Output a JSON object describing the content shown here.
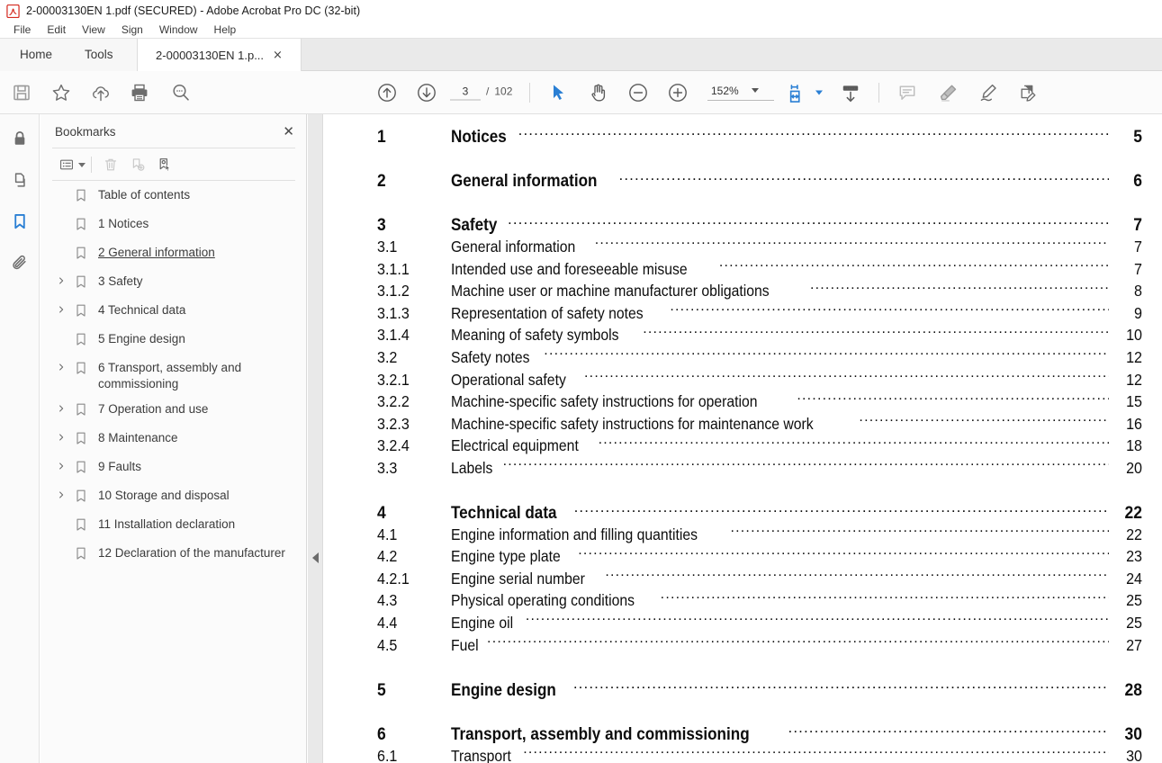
{
  "window": {
    "title": "2-00003130EN 1.pdf (SECURED) - Adobe Acrobat Pro DC (32-bit)",
    "app_icon": "acrobat-icon"
  },
  "menubar": {
    "items": [
      "File",
      "Edit",
      "View",
      "Sign",
      "Window",
      "Help"
    ]
  },
  "tabstrip": {
    "home_label": "Home",
    "tools_label": "Tools",
    "document_tab_label": "2-00003130EN 1.p...",
    "close_glyph": "×"
  },
  "toolbar": {
    "left_icons": [
      "save-icon",
      "star-icon",
      "cloud-upload-icon",
      "print-icon",
      "search-icon"
    ],
    "nav": {
      "previous_page_icon": "arrow-up-circle-icon",
      "next_page_icon": "arrow-down-circle-icon",
      "current_page": "3",
      "page_separator": "/",
      "total_pages": "102"
    },
    "tools": {
      "select_icon": "cursor-arrow-icon",
      "pan_icon": "hand-icon",
      "zoom_out_icon": "minus-circle-icon",
      "zoom_in_icon": "plus-circle-icon",
      "zoom_level": "152%",
      "zoom_dropdown_icon": "chevron-down-icon"
    },
    "right_tools": {
      "fit_page_icon": "fit-page-icon",
      "fit_page_dropdown_icon": "chevron-down-icon",
      "scroll_mode_icon": "scroll-mode-icon",
      "comment_icon": "comment-icon",
      "highlight_icon": "highlight-marker-icon",
      "sign_icon": "sign-pen-icon",
      "fill_and_sign_icon": "fill-and-sign-icon"
    }
  },
  "rail": {
    "items": [
      {
        "name": "security-lock-icon",
        "active": false
      },
      {
        "name": "page-thumbnails-icon",
        "active": false
      },
      {
        "name": "bookmarks-icon",
        "active": true
      },
      {
        "name": "attachments-icon",
        "active": false
      }
    ]
  },
  "panel": {
    "title": "Bookmarks",
    "close_glyph": "✕",
    "tools": {
      "options_icon": "bookmark-options-icon",
      "options_caret_icon": "chevron-down-icon",
      "delete_icon": "trash-icon",
      "new_bookmark_icon": "new-bookmark-icon",
      "select_bookmark_icon": "select-bookmark-icon"
    },
    "bookmarks": [
      {
        "label": "Table of contents",
        "expandable": false,
        "underlined": false
      },
      {
        "label": "1 Notices",
        "expandable": false,
        "underlined": false
      },
      {
        "label": "2 General information",
        "expandable": false,
        "underlined": true
      },
      {
        "label": "3 Safety",
        "expandable": true,
        "underlined": false
      },
      {
        "label": "4 Technical data",
        "expandable": true,
        "underlined": false
      },
      {
        "label": "5 Engine design",
        "expandable": false,
        "underlined": false
      },
      {
        "label": "6 Transport, assembly and commissioning",
        "expandable": true,
        "underlined": false
      },
      {
        "label": "7 Operation and use",
        "expandable": true,
        "underlined": false
      },
      {
        "label": "8 Maintenance",
        "expandable": true,
        "underlined": false
      },
      {
        "label": "9 Faults",
        "expandable": true,
        "underlined": false
      },
      {
        "label": "10 Storage and disposal",
        "expandable": true,
        "underlined": false
      },
      {
        "label": "11 Installation declaration",
        "expandable": false,
        "underlined": false
      },
      {
        "label": "12 Declaration of the manufacturer",
        "expandable": false,
        "underlined": false
      }
    ]
  },
  "splitter": {
    "collapse_icon": "collapse-panel-triangle-icon"
  },
  "document": {
    "toc_entries": [
      {
        "num": "1",
        "title": "Notices",
        "page": "5",
        "level": 1,
        "gap_before": false
      },
      {
        "num": "2",
        "title": "General information",
        "page": "6",
        "level": 1,
        "gap_before": true
      },
      {
        "num": "3",
        "title": "Safety",
        "page": "7",
        "level": 1,
        "gap_before": true
      },
      {
        "num": "3.1",
        "title": "General information",
        "page": "7",
        "level": 2,
        "gap_before": false
      },
      {
        "num": "3.1.1",
        "title": "Intended use and foreseeable misuse",
        "page": "7",
        "level": 2,
        "gap_before": false
      },
      {
        "num": "3.1.2",
        "title": "Machine user or machine manufacturer obligations",
        "page": "8",
        "level": 2,
        "gap_before": false
      },
      {
        "num": "3.1.3",
        "title": "Representation of safety notes",
        "page": "9",
        "level": 2,
        "gap_before": false
      },
      {
        "num": "3.1.4",
        "title": "Meaning of safety symbols",
        "page": "10",
        "level": 2,
        "gap_before": false
      },
      {
        "num": "3.2",
        "title": "Safety notes",
        "page": "12",
        "level": 2,
        "gap_before": false
      },
      {
        "num": "3.2.1",
        "title": "Operational safety",
        "page": "12",
        "level": 2,
        "gap_before": false
      },
      {
        "num": "3.2.2",
        "title": "Machine-specific safety instructions for operation",
        "page": "15",
        "level": 2,
        "gap_before": false
      },
      {
        "num": "3.2.3",
        "title": "Machine-specific safety instructions for maintenance work",
        "page": "16",
        "level": 2,
        "gap_before": false
      },
      {
        "num": "3.2.4",
        "title": "Electrical equipment",
        "page": "18",
        "level": 2,
        "gap_before": false
      },
      {
        "num": "3.3",
        "title": "Labels",
        "page": "20",
        "level": 2,
        "gap_before": false
      },
      {
        "num": "4",
        "title": "Technical data",
        "page": "22",
        "level": 1,
        "gap_before": true
      },
      {
        "num": "4.1",
        "title": "Engine information and filling quantities",
        "page": "22",
        "level": 2,
        "gap_before": false
      },
      {
        "num": "4.2",
        "title": "Engine type plate",
        "page": "23",
        "level": 2,
        "gap_before": false
      },
      {
        "num": "4.2.1",
        "title": "Engine serial number",
        "page": "24",
        "level": 2,
        "gap_before": false
      },
      {
        "num": "4.3",
        "title": "Physical operating conditions",
        "page": "25",
        "level": 2,
        "gap_before": false
      },
      {
        "num": "4.4",
        "title": "Engine oil",
        "page": "25",
        "level": 2,
        "gap_before": false
      },
      {
        "num": "4.5",
        "title": "Fuel",
        "page": "27",
        "level": 2,
        "gap_before": false
      },
      {
        "num": "5",
        "title": "Engine design",
        "page": "28",
        "level": 1,
        "gap_before": true
      },
      {
        "num": "6",
        "title": "Transport, assembly and commissioning",
        "page": "30",
        "level": 1,
        "gap_before": true
      },
      {
        "num": "6.1",
        "title": "Transport",
        "page": "30",
        "level": 2,
        "gap_before": false
      }
    ]
  },
  "colors": {
    "accent_blue": "#2a7fd4",
    "acrobat_red": "#d42a20",
    "toolbar_bg": "#fbfbfb",
    "panel_bg": "#fbfbfb",
    "tabstrip_bg": "#eaeaea"
  }
}
